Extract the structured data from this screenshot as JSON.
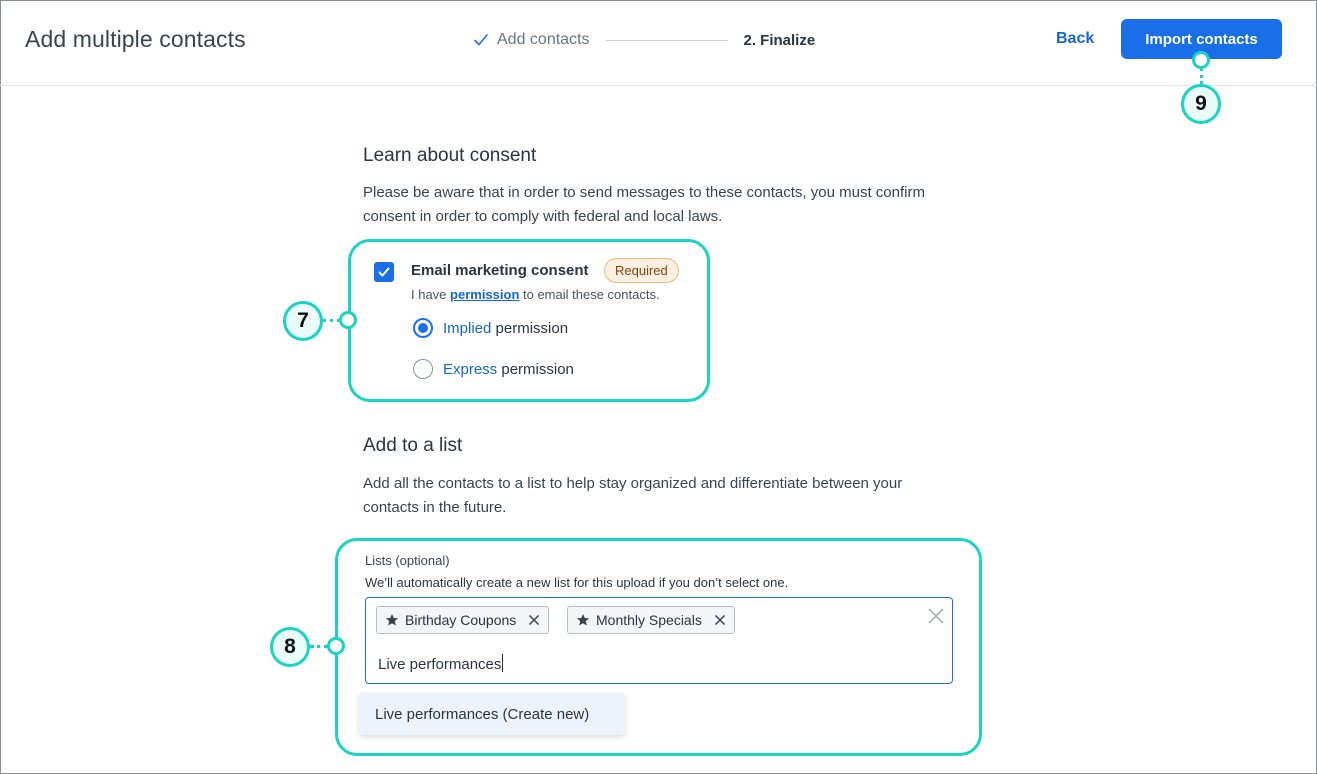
{
  "header": {
    "title": "Add multiple contacts",
    "steps": [
      {
        "label": "Add contacts",
        "state": "complete"
      },
      {
        "label": "2.  Finalize",
        "state": "current"
      }
    ],
    "back_label": "Back",
    "import_label": "Import contacts"
  },
  "callouts": {
    "consent": "7",
    "lists": "8",
    "import": "9"
  },
  "consent": {
    "title": "Learn about consent",
    "description": "Please be aware that in order to send messages to these contacts, you must confirm consent in order to comply with federal and local laws.",
    "checkbox_label": "Email marketing consent",
    "checkbox_checked": true,
    "badge": "Required",
    "sub_prefix": "I have ",
    "sub_link": "permission",
    "sub_suffix": " to email these contacts.",
    "options": [
      {
        "highlight": "Implied",
        "rest": " permission",
        "selected": true
      },
      {
        "highlight": "Express",
        "rest": " permission",
        "selected": false
      }
    ]
  },
  "lists": {
    "title": "Add to a list",
    "description": "Add all the contacts to a list to help stay organized and differentiate between your contacts in the future.",
    "field_label": "Lists (optional)",
    "field_help": "We’ll automatically create a new list for this upload if you don’t select one.",
    "selected": [
      "Birthday Coupons",
      "Monthly Specials"
    ],
    "typed_value": "Live performances",
    "suggestion": "Live performances (Create new)"
  },
  "colors": {
    "accent": "#1a6fe8",
    "callout": "#19d3c5",
    "badge_bg": "#fdf0e2",
    "badge_text": "#8a3f08"
  }
}
